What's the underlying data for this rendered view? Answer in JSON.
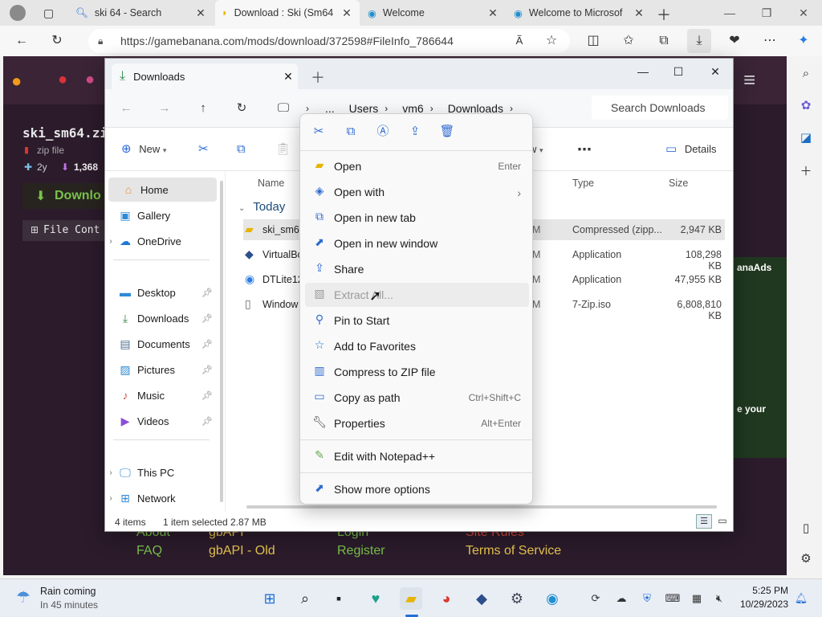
{
  "browser": {
    "tabs": [
      {
        "title": "",
        "active": false
      },
      {
        "title": "ski 64 - Search",
        "active": false
      },
      {
        "title": "Download : Ski (Sm64",
        "active": true
      },
      {
        "title": "Welcome",
        "active": false
      },
      {
        "title": "Welcome to Microsof",
        "active": false
      }
    ],
    "url": "https://gamebanana.com/mods/download/372598#FileInfo_786644"
  },
  "site": {
    "file_title": "ski_sm64.zi",
    "file_type": "zip file",
    "age": "2y",
    "downloads": "1,368",
    "download_label": "Downlo",
    "file_contents_label": "File Cont",
    "footer": {
      "col1": [
        "About",
        "FAQ"
      ],
      "col2": [
        "gbAPI",
        "gbAPI - Old"
      ],
      "col3": [
        "Login",
        "Register"
      ],
      "col4": [
        "Site Rules",
        "Terms of Service"
      ]
    },
    "ad_text_1": "anaAds",
    "ad_text_2": "e your"
  },
  "explorer": {
    "tab_label": "Downloads",
    "breadcrumbs": [
      "...",
      "Users",
      "vm6",
      "Downloads"
    ],
    "search_placeholder": "Search Downloads",
    "toolbar": {
      "new_label": "New",
      "view_label": "w",
      "details_label": "Details"
    },
    "nav_items": [
      {
        "label": "Home",
        "icon": "home",
        "selected": true
      },
      {
        "label": "Gallery",
        "icon": "gallery"
      },
      {
        "label": "OneDrive",
        "icon": "cloud",
        "expandable": true
      },
      {
        "label": "Desktop",
        "icon": "desktop",
        "pinned": true
      },
      {
        "label": "Downloads",
        "icon": "download",
        "pinned": true
      },
      {
        "label": "Documents",
        "icon": "documents",
        "pinned": true
      },
      {
        "label": "Pictures",
        "icon": "pictures",
        "pinned": true
      },
      {
        "label": "Music",
        "icon": "music",
        "pinned": true
      },
      {
        "label": "Videos",
        "icon": "videos",
        "pinned": true
      },
      {
        "label": "This PC",
        "icon": "pc",
        "expandable": true
      },
      {
        "label": "Network",
        "icon": "network",
        "expandable": true
      }
    ],
    "columns": {
      "name": "Name",
      "type": "Type",
      "size": "Size"
    },
    "group_label": "Today",
    "files": [
      {
        "name": "ski_sm64",
        "date": "M",
        "type": "Compressed (zipp...",
        "size": "2,947 KB",
        "selected": true
      },
      {
        "name": "VirtualBo",
        "date": "M",
        "type": "Application",
        "size": "108,298 KB"
      },
      {
        "name": "DTLite12",
        "date": "M",
        "type": "Application",
        "size": "47,955 KB"
      },
      {
        "name": "Window",
        "date": "M",
        "type": "7-Zip.iso",
        "size": "6,808,810 KB"
      }
    ],
    "status": {
      "count": "4 items",
      "selection": "1 item selected  2.87 MB"
    }
  },
  "context_menu": {
    "quick_actions": [
      "cut",
      "copy",
      "rename",
      "share",
      "delete"
    ],
    "items": [
      {
        "label": "Open",
        "shortcut": "Enter",
        "icon": "open"
      },
      {
        "label": "Open with",
        "shortcut": "",
        "icon": "open-with",
        "submenu": true
      },
      {
        "label": "Open in new tab",
        "shortcut": "",
        "icon": "new-tab"
      },
      {
        "label": "Open in new window",
        "shortcut": "",
        "icon": "new-window"
      },
      {
        "label": "Share",
        "shortcut": "",
        "icon": "share"
      },
      {
        "label": "Extract All...",
        "shortcut": "",
        "icon": "extract",
        "disabled": true
      },
      {
        "label": "Pin to Start",
        "shortcut": "",
        "icon": "pin"
      },
      {
        "label": "Add to Favorites",
        "shortcut": "",
        "icon": "star"
      },
      {
        "label": "Compress to ZIP file",
        "shortcut": "",
        "icon": "zip"
      },
      {
        "label": "Copy as path",
        "shortcut": "Ctrl+Shift+C",
        "icon": "copy-path"
      },
      {
        "label": "Properties",
        "shortcut": "Alt+Enter",
        "icon": "properties"
      },
      {
        "label": "Edit with Notepad++",
        "shortcut": "",
        "icon": "notepad"
      },
      {
        "label": "Show more options",
        "shortcut": "",
        "icon": "more-options"
      }
    ]
  },
  "taskbar": {
    "weather_title": "Rain coming",
    "weather_sub": "In 45 minutes",
    "time": "5:25 PM",
    "date": "10/29/2023"
  }
}
